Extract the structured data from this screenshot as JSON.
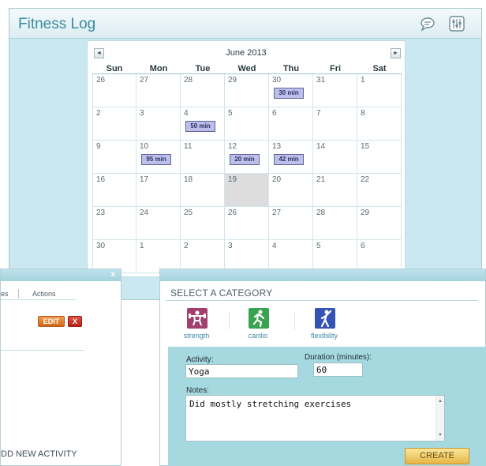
{
  "app": {
    "title": "Fitness Log"
  },
  "header": {
    "icons": [
      "chat-icon",
      "settings-icon"
    ]
  },
  "calendar": {
    "month_label": "June 2013",
    "prev_glyph": "◄",
    "next_glyph": "►",
    "weekdays": [
      "Sun",
      "Mon",
      "Tue",
      "Wed",
      "Thu",
      "Fri",
      "Sat"
    ],
    "weeks": [
      [
        {
          "n": "26"
        },
        {
          "n": "27"
        },
        {
          "n": "28"
        },
        {
          "n": "29"
        },
        {
          "n": "30",
          "badge": "30 min"
        },
        {
          "n": "31"
        },
        {
          "n": "1"
        }
      ],
      [
        {
          "n": "2"
        },
        {
          "n": "3"
        },
        {
          "n": "4",
          "badge": "50 min"
        },
        {
          "n": "5"
        },
        {
          "n": "6"
        },
        {
          "n": "7"
        },
        {
          "n": "8"
        }
      ],
      [
        {
          "n": "9"
        },
        {
          "n": "10",
          "badge": "95 min"
        },
        {
          "n": "11"
        },
        {
          "n": "12",
          "badge": "20 min"
        },
        {
          "n": "13",
          "badge": "42 min"
        },
        {
          "n": "14"
        },
        {
          "n": "15"
        }
      ],
      [
        {
          "n": "16"
        },
        {
          "n": "17"
        },
        {
          "n": "18"
        },
        {
          "n": "19",
          "today": true
        },
        {
          "n": "20"
        },
        {
          "n": "21"
        },
        {
          "n": "22"
        }
      ],
      [
        {
          "n": "23"
        },
        {
          "n": "24"
        },
        {
          "n": "25"
        },
        {
          "n": "26"
        },
        {
          "n": "27"
        },
        {
          "n": "28"
        },
        {
          "n": "29"
        }
      ],
      [
        {
          "n": "30"
        },
        {
          "n": "1"
        },
        {
          "n": "2"
        },
        {
          "n": "3"
        },
        {
          "n": "4"
        },
        {
          "n": "5"
        },
        {
          "n": "6"
        }
      ]
    ]
  },
  "activity_panel": {
    "close_label": "x",
    "columns_partial": "es",
    "columns_actions": "Actions",
    "edit_label": "EDIT",
    "delete_label": "X",
    "add_link": "DD NEW ACTIVITY"
  },
  "category_panel": {
    "title": "SELECT A CATEGORY",
    "categories": [
      {
        "label": "strength",
        "icon": "weightlifter-icon",
        "color": "#a23f6d"
      },
      {
        "label": "cardio",
        "icon": "runner-icon",
        "color": "#3aa34f"
      },
      {
        "label": "flexibility",
        "icon": "stretching-person-icon",
        "color": "#3553b5"
      }
    ],
    "activity_label": "Activity:",
    "activity_value": "Yoga",
    "duration_label": "Duration (minutes):",
    "duration_value": "60",
    "notes_label": "Notes:",
    "notes_value": "Did mostly stretching exercises",
    "create_label": "CREATE"
  }
}
